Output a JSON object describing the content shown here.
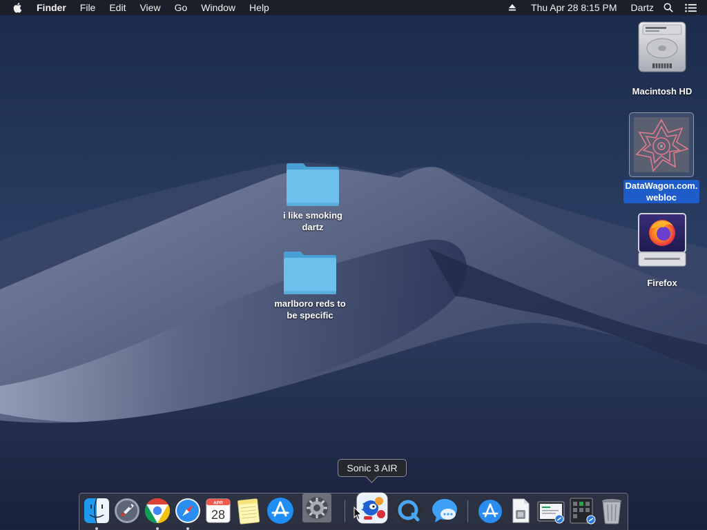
{
  "menubar": {
    "apple_icon": "apple-logo-icon",
    "app_name": "Finder",
    "menus": [
      "File",
      "Edit",
      "View",
      "Go",
      "Window",
      "Help"
    ],
    "clock": "Thu Apr 28  8:15 PM",
    "user": "Dartz",
    "status_icons": [
      "eject-icon",
      "spotlight-search-icon",
      "notification-center-icon"
    ]
  },
  "desktop": {
    "items": [
      {
        "label_line1": "i like smoking",
        "label_line2": "dartz",
        "icon": "folder-icon"
      },
      {
        "label_line1": "marlboro reds to",
        "label_line2": "be specific",
        "icon": "folder-icon"
      },
      {
        "label": "Macintosh HD",
        "icon": "hard-drive-icon"
      },
      {
        "label_line1": "DataWagon.com.",
        "label_line2": "webloc",
        "icon": "webloc-thumbnail-icon",
        "selected": true
      },
      {
        "label": "Firefox",
        "icon": "firefox-disk-image-icon"
      }
    ]
  },
  "dock": {
    "tooltip": "Sonic 3 AIR",
    "calendar_month": "APR",
    "calendar_day": "28",
    "apps": [
      {
        "icon": "finder-icon",
        "running": true
      },
      {
        "icon": "launchpad-icon",
        "running": false
      },
      {
        "icon": "chrome-icon",
        "running": true
      },
      {
        "icon": "safari-icon",
        "running": true
      },
      {
        "icon": "calendar-icon",
        "running": false
      },
      {
        "icon": "notes-icon",
        "running": false
      },
      {
        "icon": "app-store-icon",
        "running": false
      },
      {
        "icon": "system-preferences-icon",
        "running": false
      },
      {
        "icon": "sonic-3-air-icon",
        "running": false
      },
      {
        "icon": "quicktime-icon",
        "running": false
      },
      {
        "icon": "messages-icon",
        "running": false
      },
      {
        "icon": "app-store-downloads-icon",
        "running": false
      },
      {
        "icon": "preview-document-icon",
        "running": false
      },
      {
        "icon": "screenshot-stack-icon",
        "running": false
      },
      {
        "icon": "apps-stack-icon",
        "running": false
      },
      {
        "icon": "trash-icon",
        "running": false
      }
    ]
  },
  "colors": {
    "selection": "#1d5cc9",
    "folder": "#5db3e3",
    "menubar": "#1c1e26"
  }
}
